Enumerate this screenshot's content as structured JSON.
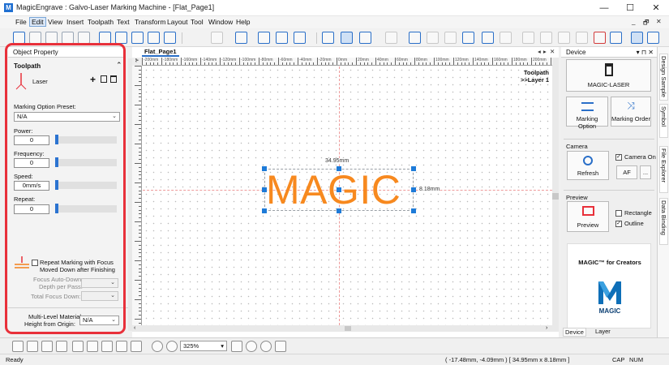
{
  "window": {
    "title": "MagicEngrave : Galvo-Laser Marking Machine - [Flat_Page1]",
    "app_icon": "M",
    "minimize": "—",
    "maximize": "☐",
    "close": "✕"
  },
  "menu": {
    "items": [
      "File",
      "Edit",
      "View",
      "Insert",
      "Toolpath",
      "Text",
      "Transform",
      "Layout",
      "Tool",
      "Window",
      "Help"
    ],
    "active": "Edit",
    "mdi_controls": [
      "_",
      "🗗",
      "✕"
    ]
  },
  "left_panel": {
    "header": "Object Property",
    "section": "Toolpath",
    "collapse_glyph": "⌃",
    "laser_label": "Laser",
    "marking_preset_label": "Marking Option Preset:",
    "marking_preset_value": "N/A",
    "power_label": "Power:",
    "power_value": "0",
    "frequency_label": "Frequency:",
    "frequency_value": "0",
    "speed_label": "Speed:",
    "speed_value": "0mm/s",
    "repeat_label": "Repeat:",
    "repeat_value": "0",
    "repeat_focus_label_1": "Repeat Marking with Focus",
    "repeat_focus_label_2": "Moved Down after Finishing",
    "focus_depth_label_1": "Focus Auto-Down",
    "focus_depth_label_2": "Depth per Pass:",
    "total_focus_label": "Total Focus Down:",
    "multi_level_label_1": "Multi-Level Material",
    "multi_level_label_2": "Height from Origin:",
    "multi_level_value": "N/A"
  },
  "document": {
    "tab_label": "Flat_Page1",
    "tab_controls": [
      "◂",
      "▸",
      "✕"
    ],
    "toolpath_title": "Toolpath",
    "layer_label": ">>Layer 1",
    "object_text": "MAGIC",
    "width_label": "34.95mm",
    "height_label": "8.18mm",
    "ruler_top_labels": [
      "-200mm",
      "-180mm",
      "-160mm",
      "-140mm",
      "-120mm",
      "-100mm",
      "-80mm",
      "-60mm",
      "-40mm",
      "-20mm",
      "0mm",
      "20mm",
      "40mm",
      "60mm",
      "80mm",
      "100mm",
      "120mm",
      "140mm",
      "160mm",
      "180mm",
      "200mm"
    ],
    "ruler_corner": "⊱"
  },
  "right_panel": {
    "header": "Device",
    "header_controls": "▾ ⊓ ✕",
    "device_name": "MAGIC-LASER",
    "marking_option_label": "Marking Option",
    "marking_order_label": "Marking Order",
    "camera_group": "Camera",
    "camera_on_label": "Camera On",
    "refresh_label": "Refresh",
    "af_label": "AF",
    "more_label": "...",
    "preview_group": "Preview",
    "rectangle_label": "Rectangle",
    "outline_label": "Outline",
    "preview_label": "Preview",
    "promo_title": "MAGIC™ for Creators",
    "promo_logo_text": "MAGIC",
    "tab_device": "Device",
    "tab_layer": "Layer"
  },
  "side_tabs": [
    "Design Sample",
    "Symbol",
    "File Explorer",
    "Data Binding"
  ],
  "bottom_toolbar": {
    "zoom_value": "325%"
  },
  "status": {
    "left": "Ready",
    "coords": "( -17.48mm, -4.09mm ) [ 34.95mm x 8.18mm ]",
    "caps": "CAP",
    "num": "NUM"
  },
  "colors": {
    "accent": "#2a6fc8",
    "highlight_red": "#e8303a",
    "object_orange": "#f7891f",
    "handle_blue": "#1e7bd8"
  }
}
